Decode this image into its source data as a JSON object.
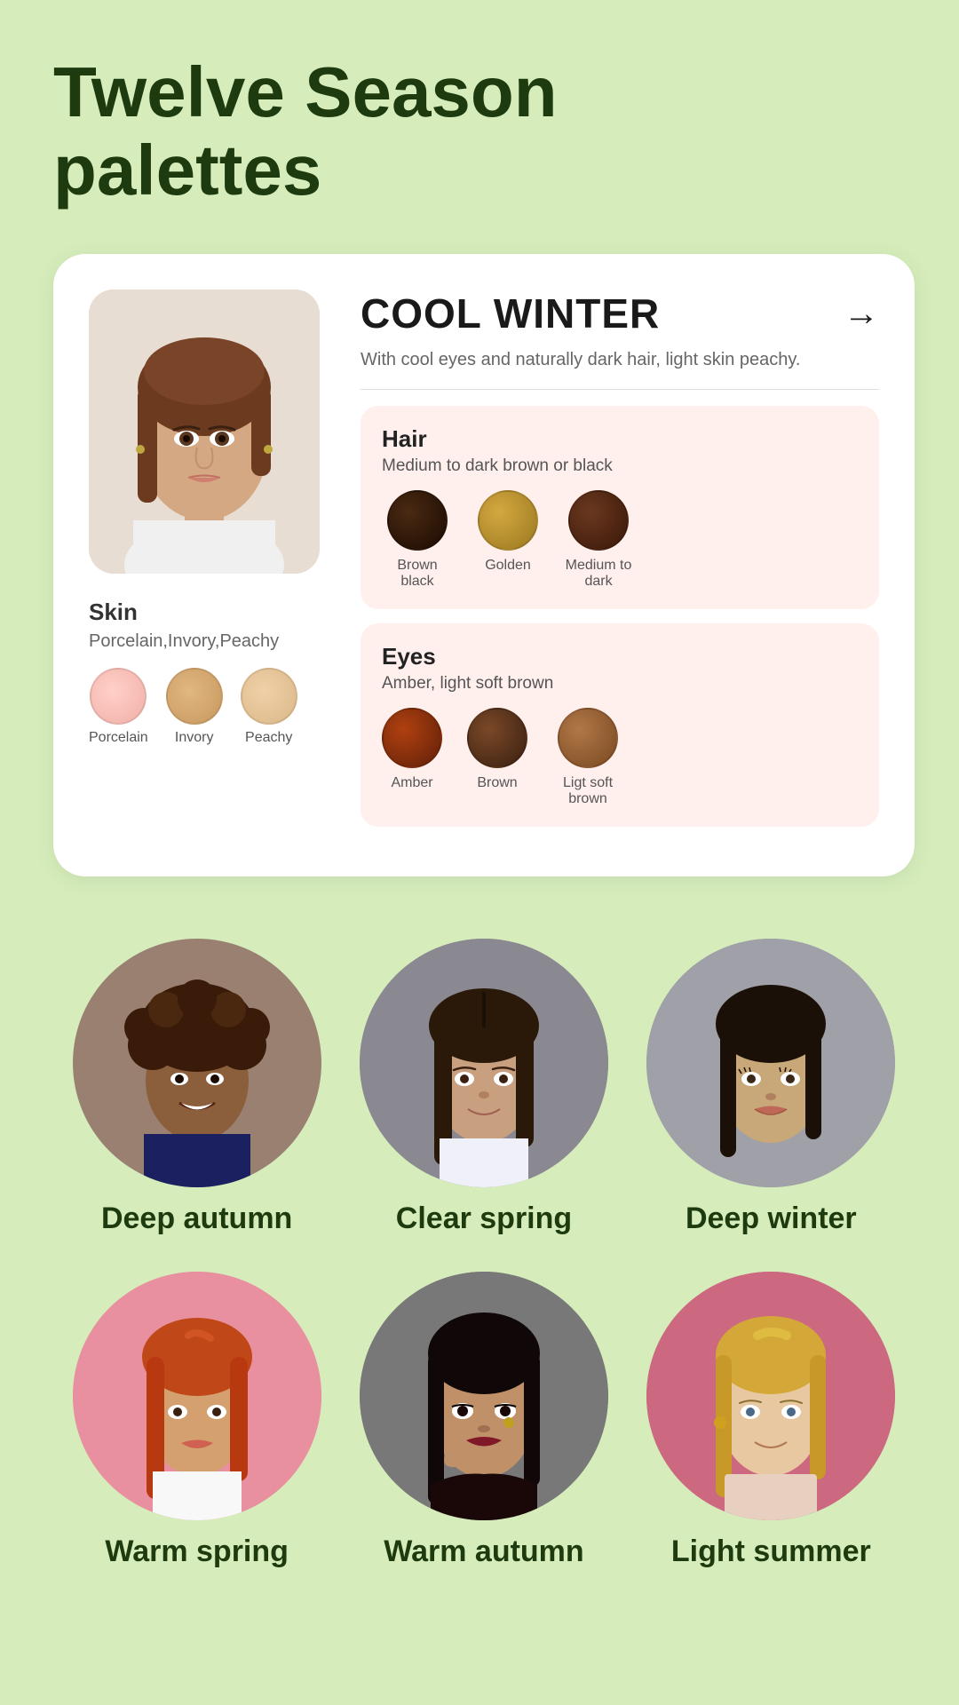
{
  "page": {
    "title": "Twelve Season\npalettes",
    "background_color": "#d6edbb"
  },
  "card": {
    "season_name": "COOL WINTER",
    "season_description": "With cool eyes and naturally dark hair, light skin peachy.",
    "arrow_label": "→",
    "hair": {
      "label": "Hair",
      "subtitle": "Medium to dark brown or black",
      "colors": [
        {
          "name": "Brown black",
          "hex": "#2a1a0e"
        },
        {
          "name": "Golden",
          "hex": "#b8943a"
        },
        {
          "name": "Medium to dark",
          "hex": "#4a2818"
        }
      ]
    },
    "eyes": {
      "label": "Eyes",
      "subtitle": "Amber, light soft brown",
      "colors": [
        {
          "name": "Amber",
          "hex": "#8b3a0a"
        },
        {
          "name": "Brown",
          "hex": "#5a3018"
        },
        {
          "name": "Ligt soft brown",
          "hex": "#8b6040"
        }
      ]
    },
    "skin": {
      "label": "Skin",
      "subtitle": "Porcelain,Invory,Peachy",
      "swatches": [
        {
          "name": "Porcelain",
          "hex": "#f0c0b8"
        },
        {
          "name": "Invory",
          "hex": "#d4aa7a"
        },
        {
          "name": "Peachy",
          "hex": "#e8c898"
        }
      ]
    }
  },
  "portraits_row1": [
    {
      "name": "Deep autumn",
      "bg": "#9a7060"
    },
    {
      "name": "Clear spring",
      "bg": "#6a6a70"
    },
    {
      "name": "Deep winter",
      "bg": "#8a8a8a"
    }
  ],
  "portraits_row2": [
    {
      "name": "Warm spring",
      "bg": "#f4a0b0"
    },
    {
      "name": "Warm autumn",
      "bg": "#888888"
    },
    {
      "name": "Light summer",
      "bg": "#cc7088"
    }
  ]
}
